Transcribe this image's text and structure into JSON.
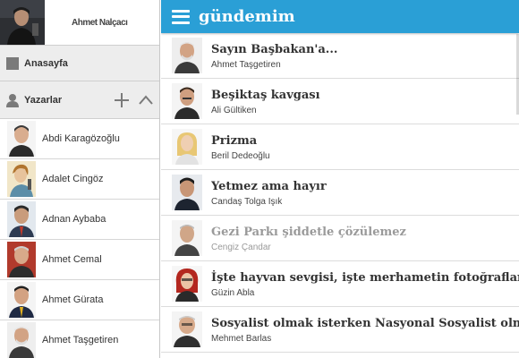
{
  "profile": {
    "name": "Ahmet Nalçacı"
  },
  "nav": {
    "home_label": "Anasayfa"
  },
  "authors_section": {
    "label": "Yazarlar"
  },
  "authors": [
    {
      "name": "Abdi Karagözoğlu"
    },
    {
      "name": "Adalet Cingöz"
    },
    {
      "name": "Adnan Aybaba"
    },
    {
      "name": "Ahmet Cemal"
    },
    {
      "name": "Ahmet Gürata"
    },
    {
      "name": "Ahmet Taşgetiren"
    }
  ],
  "app": {
    "title": "gündemim",
    "accent_color": "#2a9fd6"
  },
  "articles": [
    {
      "title": "Sayın Başbakan'a...",
      "author": "Ahmet Taşgetiren",
      "read": false
    },
    {
      "title": "Beşiktaş kavgası",
      "author": "Ali Gültiken",
      "read": false
    },
    {
      "title": "Prizma",
      "author": "Beril Dedeoğlu",
      "read": false
    },
    {
      "title": "Yetmez ama hayır",
      "author": "Candaş Tolga Işık",
      "read": false
    },
    {
      "title": "Gezi Parkı şiddetle çözülemez",
      "author": "Cengiz Çandar",
      "read": true
    },
    {
      "title": "İşte hayvan sevgisi, işte merhametin fotoğrafları!",
      "author": "Güzin Abla",
      "read": false
    },
    {
      "title": "Sosyalist olmak isterken Nasyonal Sosyalist olmak",
      "author": "Mehmet Barlas",
      "read": false
    }
  ]
}
